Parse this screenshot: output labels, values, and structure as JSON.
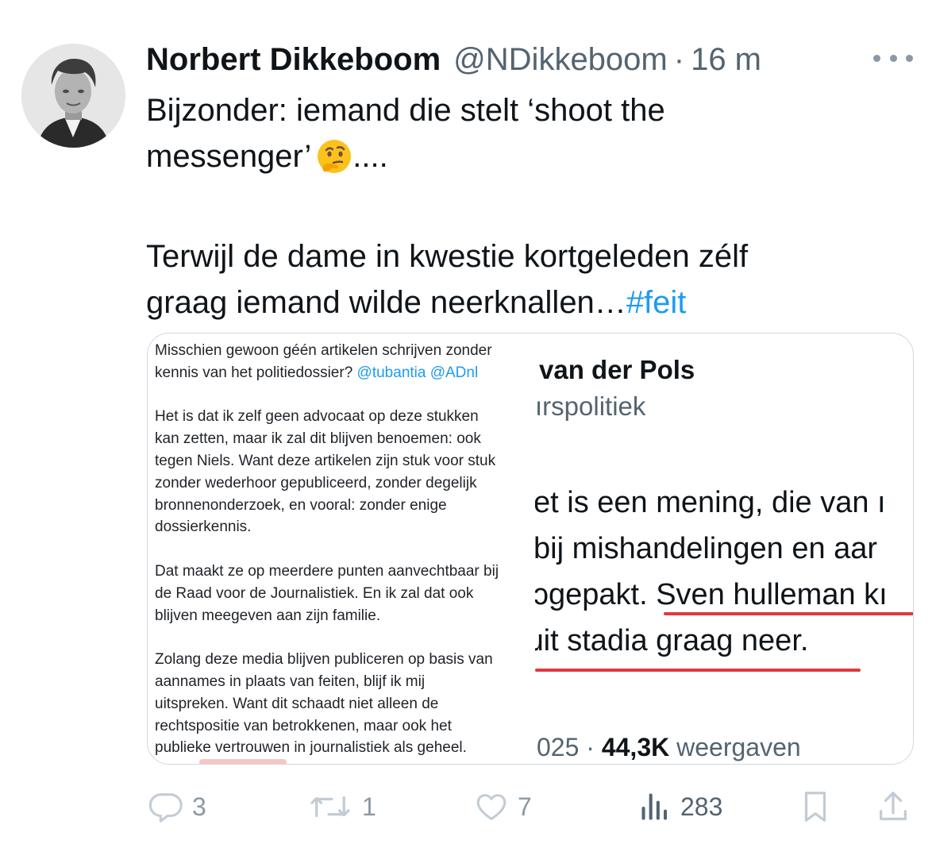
{
  "author": {
    "name": "Norbert Dikkeboom",
    "handle": "@NDikkeboom",
    "separator": "·",
    "time": "16 m"
  },
  "tweet": {
    "line1": "Bijzonder: iemand die stelt ‘shoot the",
    "line2": "messenger’",
    "emoji_icon": "thinking-face-icon",
    "line2_suffix": "....",
    "line3": "Terwijl de dame in kwestie kortgeleden zélf",
    "line4": "graag iemand wilde neerknallen…",
    "hashtag": "#feit"
  },
  "media": {
    "left": {
      "p1_l1": "Misschien gewoon géén artikelen schrijven zonder",
      "p1_l2": "kennis van het politiedossier?",
      "p1_mentions": "@tubantia @ADnl",
      "p2_l1": "Het is dat ik zelf geen advocaat op deze stukken",
      "p2_l2": "kan zetten, maar ik zal dit blijven benoemen: ook",
      "p2_l3": "tegen Niels. Want deze artikelen zijn stuk voor stuk",
      "p2_l4": "zonder wederhoor gepubliceerd, zonder degelijk",
      "p2_l5": "bronnenonderzoek, en vooral: zonder enige",
      "p2_l6": "dossierkennis.",
      "p3_l1": "Dat maakt ze op meerdere punten aanvechtbaar bij",
      "p3_l2": "de Raad voor de Journalistiek. En ik zal dat ook",
      "p3_l3": "blijven meegeven aan zijn familie.",
      "p4_l1": "Zolang deze media blijven publiceren op basis van",
      "p4_l2": "aannames in plaats van feiten, blijf ik mij",
      "p4_l3": "uitspreken. Want dit schaadt niet alleen de",
      "p4_l4": "rechtspositie van betrokkenen, maar ook het",
      "p4_l5": "publieke vertrouwen in journalistiek als geheel."
    },
    "right": {
      "name": "van der Pols",
      "handle": "ırspolitiek",
      "line1": "et is een mening, die van ı",
      "line2": "bij mishandelingen en aar",
      "line3": "ɔgepakt. Sven hulleman kı",
      "line4": "ɹit stadia graag neer.",
      "stats_prefix": "025 · ",
      "stats_views": "44,3K",
      "stats_suffix": " weergaven"
    }
  },
  "actions": {
    "reply_icon": "reply-icon",
    "reply_count": "3",
    "retweet_icon": "retweet-icon",
    "retweet_count": "1",
    "like_icon": "heart-icon",
    "like_count": "7",
    "views_icon": "views-bar-chart-icon",
    "views_count": "283",
    "bookmark_icon": "bookmark-icon",
    "share_icon": "share-icon"
  },
  "colors": {
    "link": "#1d9bf0",
    "secondary_text": "#536471",
    "action_icon": "#8b98a5",
    "highlight_underline": "#e0393e"
  }
}
